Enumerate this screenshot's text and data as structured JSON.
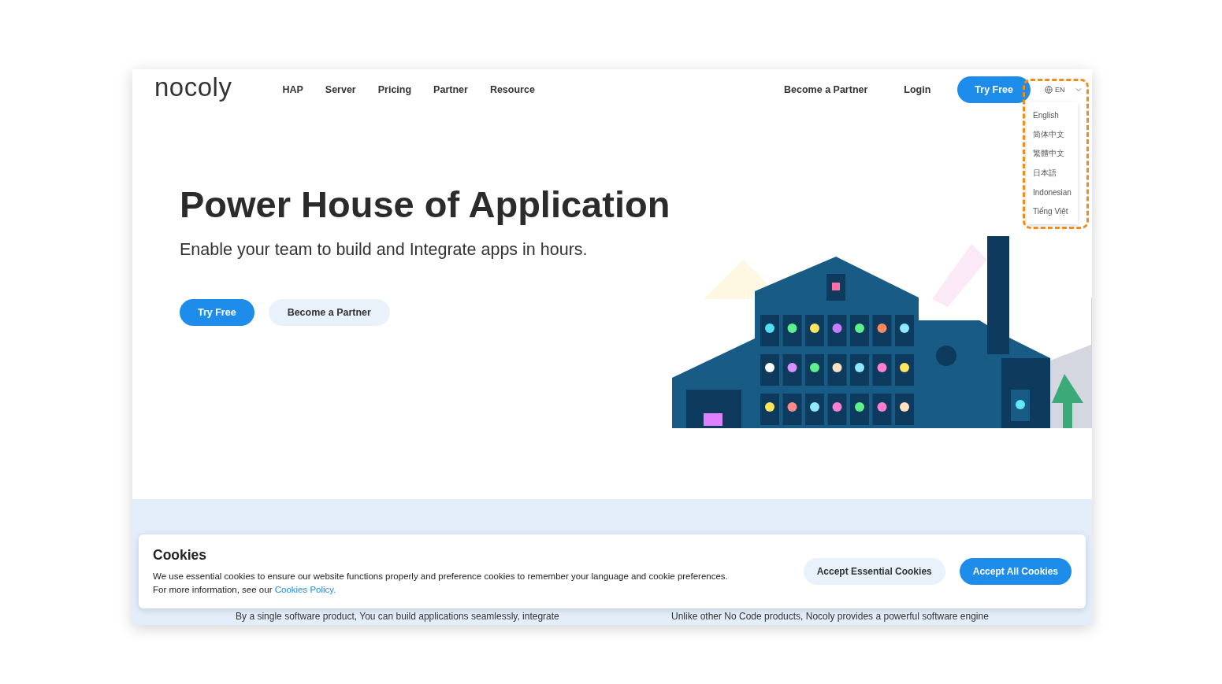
{
  "header": {
    "logo": "nocoly",
    "nav": [
      "HAP",
      "Server",
      "Pricing",
      "Partner",
      "Resource"
    ],
    "become_partner": "Become a Partner",
    "login": "Login",
    "try_free": "Try Free",
    "language": {
      "current": "EN",
      "expanded": true,
      "options": [
        "English",
        "简体中文",
        "繁體中文",
        "日本語",
        "Indonesian",
        "Tiếng Việt"
      ]
    }
  },
  "hero": {
    "title": "Power House of Application",
    "subtitle": "Enable your team to build and Integrate apps in hours.",
    "buttons": [
      {
        "label": "Try Free",
        "kind": "primary"
      },
      {
        "label": "Become a Partner",
        "kind": "secondary"
      }
    ]
  },
  "features": [
    "By a single software product, You can build applications seamlessly, integrate",
    "Unlike other No Code products, Nocoly provides a powerful software engine"
  ],
  "cookies": {
    "title": "Cookies",
    "text": "We use essential cookies to ensure our website functions properly and preference cookies to remember your language and cookie preferences.",
    "more": "For more information, see our",
    "link": "Cookies Policy.",
    "buttons": [
      {
        "label": "Accept Essential Cookies",
        "kind": "secondary"
      },
      {
        "label": "Accept All Cookies",
        "kind": "primary"
      }
    ]
  }
}
